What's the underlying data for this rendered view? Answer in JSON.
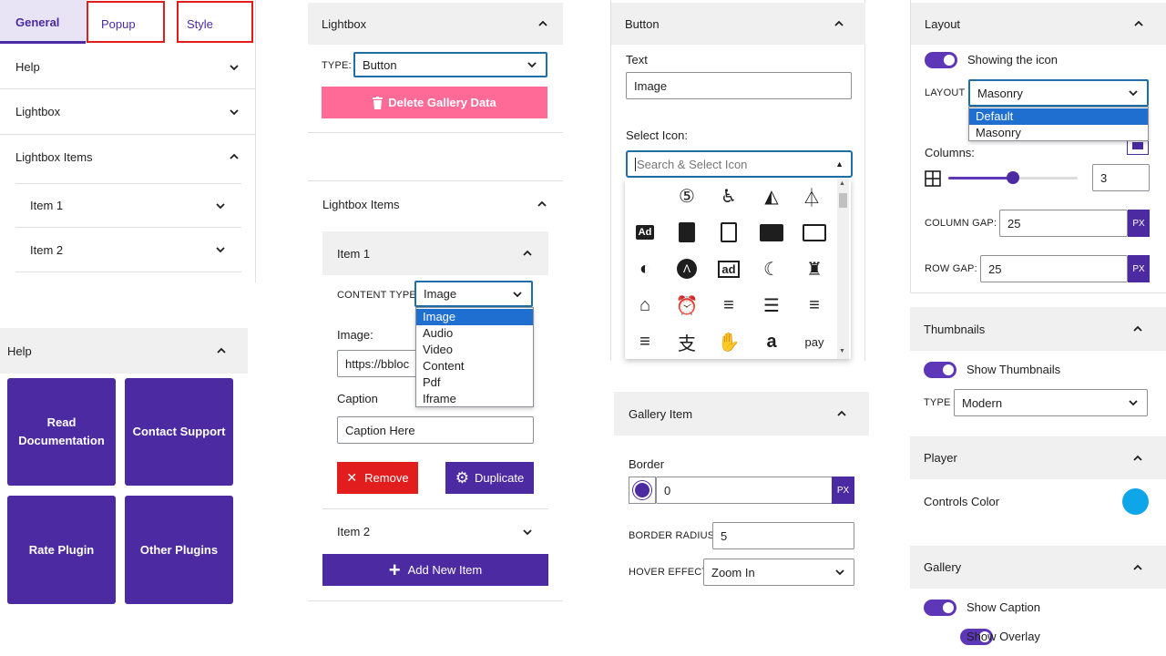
{
  "col1": {
    "tabs": [
      {
        "label": "General"
      },
      {
        "label": "Popup"
      },
      {
        "label": "Style"
      }
    ],
    "rows": [
      {
        "label": "Help"
      },
      {
        "label": "Lightbox"
      },
      {
        "label": "Lightbox Items"
      }
    ],
    "subrows": [
      {
        "label": "Item 1"
      },
      {
        "label": "Item 2"
      }
    ],
    "help_panel": {
      "title": "Help",
      "tiles": [
        {
          "label": "Read Documentation"
        },
        {
          "label": "Contact Support"
        },
        {
          "label": "Rate Plugin"
        },
        {
          "label": "Other Plugins"
        }
      ]
    }
  },
  "col2": {
    "lightbox": {
      "title": "Lightbox",
      "type_label": "TYPE:",
      "type_value": "Button",
      "delete_label": "Delete Gallery Data"
    },
    "items_panel": {
      "title": "Lightbox Items",
      "item1_title": "Item 1",
      "content_type_label": "CONTENT TYPE",
      "content_type_value": "Image",
      "content_type_options": [
        "Image",
        "Audio",
        "Video",
        "Content",
        "Pdf",
        "Iframe"
      ],
      "image_label": "Image:",
      "image_value": "https://bbloc",
      "caption_label": "Caption",
      "caption_placeholder": "Caption Here",
      "remove_label": "Remove",
      "duplicate_label": "Duplicate",
      "item2_title": "Item 2",
      "add_label": "Add New Item"
    }
  },
  "col3": {
    "button_panel": {
      "title": "Button",
      "text_label": "Text",
      "text_value": "Image",
      "select_icon_label": "Select Icon:",
      "search_placeholder": "Search & Select Icon"
    },
    "gallery_item": {
      "title": "Gallery Item",
      "border_label": "Border",
      "border_value": "0",
      "border_unit": "PX",
      "border_color": "#4b2aa2",
      "radius_label": "BORDER RADIUS",
      "radius_value": "5",
      "hover_label": "HOVER EFFECT",
      "hover_value": "Zoom In"
    }
  },
  "col4": {
    "layout": {
      "title": "Layout",
      "showing_icon_label": "Showing the icon",
      "layout_label": "LAYOUT",
      "layout_value": "Masonry",
      "layout_options": [
        "Default",
        "Masonry"
      ],
      "columns_label": "Columns:",
      "columns_value": "3",
      "columns_fraction": 0.5,
      "column_gap_label": "COLUMN GAP:",
      "column_gap_value": "25",
      "row_gap_label": "ROW GAP:",
      "row_gap_value": "25",
      "unit": "PX"
    },
    "thumbnails": {
      "title": "Thumbnails",
      "show_label": "Show Thumbnails",
      "type_label": "TYPE",
      "type_value": "Modern"
    },
    "player": {
      "title": "Player",
      "controls_label": "Controls Color",
      "controls_color": "#0ea5e9"
    },
    "gallery": {
      "title": "Gallery",
      "show_caption_label": "Show Caption",
      "show_overlay_label": "Show Overlay"
    }
  },
  "colors": {
    "accent": "#4b2aa2",
    "danger": "#e11d1d",
    "delete_pink": "#ff6b96",
    "toggle": "#5d37b8"
  }
}
